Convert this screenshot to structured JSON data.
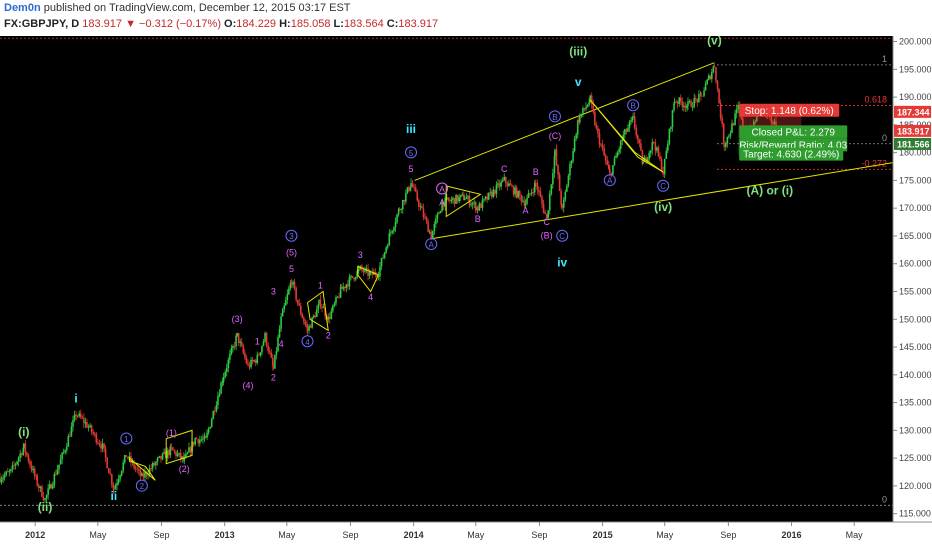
{
  "header": {
    "user": "Dem0n",
    "published": " published on TradingView.com, December 12, 2015 03:17 EST",
    "symbol": "FX:GBPJPY, D",
    "last": "183.917",
    "change": "−0.312 (−0.17%)",
    "open_label": "O:",
    "open": "184.229",
    "high_label": "H:",
    "high": "185.058",
    "low_label": "L:",
    "low": "183.564",
    "close_label": "C:",
    "close": "183.917"
  },
  "colors": {
    "background": "#000000",
    "up": "#2ecc40",
    "down": "#e53935",
    "trendline": "#e6e600",
    "wave_green": "#7ee37e",
    "wave_cyan": "#3ee8ff",
    "wave_magenta": "#e066ff",
    "wave_blue": "#6a6aff"
  },
  "chart_data": {
    "type": "candlestick",
    "title": "",
    "xlabel": "",
    "ylabel": "",
    "x_ticks": [
      "2012",
      "May",
      "Sep",
      "2013",
      "May",
      "Sep",
      "2014",
      "May",
      "Sep",
      "2015",
      "May",
      "Sep",
      "2016",
      "May"
    ],
    "y_ticks": [
      115,
      120,
      125,
      130,
      135,
      140,
      145,
      150,
      155,
      160,
      165,
      170,
      175,
      180,
      185,
      190,
      195,
      200
    ],
    "ylim": [
      113.5,
      201
    ],
    "xlim": [
      "2011-10-25",
      "2016-07-15"
    ],
    "price_path": [
      [
        "2011-10-25",
        121.5
      ],
      [
        "2011-11-15",
        122.5
      ],
      [
        "2011-12-10",
        127
      ],
      [
        "2012-01-05",
        120.5
      ],
      [
        "2012-01-20",
        117.5
      ],
      [
        "2012-02-25",
        126
      ],
      [
        "2012-03-20",
        133
      ],
      [
        "2012-04-10",
        131
      ],
      [
        "2012-05-10",
        127
      ],
      [
        "2012-06-01",
        119.5
      ],
      [
        "2012-06-25",
        125.5
      ],
      [
        "2012-07-25",
        121.5
      ],
      [
        "2012-08-25",
        124.5
      ],
      [
        "2012-09-20",
        126.5
      ],
      [
        "2012-10-15",
        124.5
      ],
      [
        "2012-11-05",
        128.5
      ],
      [
        "2012-11-25",
        128.2
      ],
      [
        "2012-12-30",
        140
      ],
      [
        "2013-01-25",
        147
      ],
      [
        "2013-02-15",
        141.5
      ],
      [
        "2013-03-05",
        143
      ],
      [
        "2013-03-20",
        147
      ],
      [
        "2013-04-05",
        141
      ],
      [
        "2013-04-20",
        150
      ],
      [
        "2013-05-10",
        157
      ],
      [
        "2013-05-25",
        152
      ],
      [
        "2013-06-10",
        148
      ],
      [
        "2013-07-05",
        153
      ],
      [
        "2013-07-20",
        150
      ],
      [
        "2013-08-15",
        155.5
      ],
      [
        "2013-09-20",
        159
      ],
      [
        "2013-10-10",
        158
      ],
      [
        "2013-10-25",
        158.5
      ],
      [
        "2013-11-15",
        165
      ],
      [
        "2013-12-05",
        170
      ],
      [
        "2013-12-27",
        174.5
      ],
      [
        "2014-02-04",
        165
      ],
      [
        "2014-02-25",
        171
      ],
      [
        "2014-04-10",
        172
      ],
      [
        "2014-05-05",
        170
      ],
      [
        "2014-06-25",
        175
      ],
      [
        "2014-08-05",
        171
      ],
      [
        "2014-08-25",
        174.5
      ],
      [
        "2014-09-15",
        168
      ],
      [
        "2014-10-01",
        180
      ],
      [
        "2014-10-15",
        169.5
      ],
      [
        "2014-11-15",
        186
      ],
      [
        "2014-12-08",
        189.5
      ],
      [
        "2014-12-20",
        184
      ],
      [
        "2015-01-15",
        176
      ],
      [
        "2015-02-10",
        183
      ],
      [
        "2015-03-01",
        186
      ],
      [
        "2015-03-20",
        178
      ],
      [
        "2015-04-10",
        182
      ],
      [
        "2015-04-28",
        176.5
      ],
      [
        "2015-05-20",
        189.5
      ],
      [
        "2015-06-15",
        188.5
      ],
      [
        "2015-07-10",
        190
      ],
      [
        "2015-08-05",
        195.8
      ],
      [
        "2015-08-24",
        181.5
      ],
      [
        "2015-09-05",
        184
      ],
      [
        "2015-09-20",
        188
      ],
      [
        "2015-10-05",
        182
      ],
      [
        "2015-11-01",
        188
      ],
      [
        "2015-11-20",
        186
      ],
      [
        "2015-12-11",
        183.9
      ]
    ],
    "price_labels": [
      {
        "text": "187.344",
        "value": 187.344,
        "color": "#e53935"
      },
      {
        "text": "183.917",
        "value": 183.917,
        "color": "#e53935"
      },
      {
        "text": "181.566",
        "value": 181.566,
        "color": "#2e7d32"
      }
    ],
    "fib_levels": [
      {
        "label": "1",
        "value": 195.8,
        "color": "#999999"
      },
      {
        "label": "0.618",
        "value": 188.5,
        "color": "#e53935"
      },
      {
        "label": "0",
        "value": 181.6,
        "color": "#999999"
      },
      {
        "label": "-0.272",
        "value": 177.0,
        "color": "#e53935"
      },
      {
        "label": "0",
        "value": 116.5,
        "color": "#999999"
      }
    ],
    "trade_boxes": [
      {
        "text": "Stop: 1.148 (0.62%)",
        "bg": "#e53935",
        "fg": "#ffffff"
      },
      {
        "text": "Closed P&L: 2.279",
        "bg": "#2e9d2e",
        "fg": "#ffffff"
      },
      {
        "text": "Risk/Reward Ratio: 4.03",
        "bg": "#2e9d2e",
        "fg": "#ffffff"
      },
      {
        "text": "Target: 4.630 (2.49%)",
        "bg": "#2e9d2e",
        "fg": "#ffffff"
      }
    ],
    "wave_labels": [
      {
        "text": "(i)",
        "date": "2011-12-10",
        "value": 129,
        "color": "green"
      },
      {
        "text": "(ii)",
        "date": "2012-01-20",
        "value": 115.5,
        "color": "green"
      },
      {
        "text": "i",
        "date": "2012-03-20",
        "value": 135,
        "color": "cyan"
      },
      {
        "text": "ii",
        "date": "2012-06-01",
        "value": 117.5,
        "color": "cyan"
      },
      {
        "text": "1",
        "date": "2012-06-25",
        "value": 128,
        "color": "blue",
        "circle": true
      },
      {
        "text": "2",
        "date": "2012-07-25",
        "value": 119.5,
        "color": "blue",
        "circle": true
      },
      {
        "text": "(1)",
        "date": "2012-09-20",
        "value": 129,
        "color": "magenta"
      },
      {
        "text": "(2)",
        "date": "2012-10-15",
        "value": 122.5,
        "color": "magenta"
      },
      {
        "text": "(3)",
        "date": "2013-01-25",
        "value": 149.5,
        "color": "magenta"
      },
      {
        "text": "1",
        "date": "2013-03-05",
        "value": 145.5,
        "color": "magenta"
      },
      {
        "text": "2",
        "date": "2013-04-05",
        "value": 139,
        "color": "magenta"
      },
      {
        "text": "(4)",
        "date": "2013-02-15",
        "value": 137.5,
        "color": "magenta"
      },
      {
        "text": "3",
        "date": "2013-04-05",
        "value": 154.5,
        "color": "magenta"
      },
      {
        "text": "4",
        "date": "2013-04-20",
        "value": 145,
        "color": "magenta"
      },
      {
        "text": "(5)",
        "date": "2013-05-10",
        "value": 161.5,
        "color": "magenta"
      },
      {
        "text": "5",
        "date": "2013-05-10",
        "value": 158.5,
        "color": "magenta"
      },
      {
        "text": "3",
        "date": "2013-05-10",
        "value": 164.5,
        "color": "blue",
        "circle": true
      },
      {
        "text": "4",
        "date": "2013-06-10",
        "value": 145.5,
        "color": "blue",
        "circle": true
      },
      {
        "text": "1",
        "date": "2013-07-05",
        "value": 155.5,
        "color": "magenta"
      },
      {
        "text": "2",
        "date": "2013-07-20",
        "value": 146.5,
        "color": "magenta"
      },
      {
        "text": "3",
        "date": "2013-09-20",
        "value": 161,
        "color": "magenta"
      },
      {
        "text": "4",
        "date": "2013-10-10",
        "value": 153.5,
        "color": "magenta"
      },
      {
        "text": "5",
        "date": "2013-12-27",
        "value": 176.5,
        "color": "magenta"
      },
      {
        "text": "5",
        "date": "2013-12-27",
        "value": 179.5,
        "color": "blue",
        "circle": true
      },
      {
        "text": "iii",
        "date": "2013-12-27",
        "value": 183.5,
        "color": "cyan"
      },
      {
        "text": "A",
        "date": "2014-02-04",
        "value": 163,
        "color": "blue",
        "circle": true
      },
      {
        "text": "A",
        "date": "2014-02-25",
        "value": 173,
        "color": "magenta",
        "circle": true
      },
      {
        "text": "A",
        "date": "2014-02-25",
        "value": 170.5,
        "color": "magenta"
      },
      {
        "text": "B",
        "date": "2014-05-05",
        "value": 167.5,
        "color": "magenta"
      },
      {
        "text": "C",
        "date": "2014-06-25",
        "value": 176.5,
        "color": "magenta"
      },
      {
        "text": "A",
        "date": "2014-08-05",
        "value": 169,
        "color": "magenta"
      },
      {
        "text": "B",
        "date": "2014-08-25",
        "value": 176,
        "color": "magenta"
      },
      {
        "text": "C",
        "date": "2014-09-15",
        "value": 167,
        "color": "magenta"
      },
      {
        "text": "(B)",
        "date": "2014-09-15",
        "value": 164.5,
        "color": "magenta"
      },
      {
        "text": "(C)",
        "date": "2014-10-01",
        "value": 182.5,
        "color": "magenta"
      },
      {
        "text": "B",
        "date": "2014-10-01",
        "value": 186,
        "color": "blue",
        "circle": true
      },
      {
        "text": "C",
        "date": "2014-10-15",
        "value": 164.5,
        "color": "blue",
        "circle": true
      },
      {
        "text": "iv",
        "date": "2014-10-15",
        "value": 159.5,
        "color": "cyan"
      },
      {
        "text": "(iii)",
        "date": "2014-11-15",
        "value": 197.5,
        "color": "green"
      },
      {
        "text": "v",
        "date": "2014-11-15",
        "value": 192,
        "color": "cyan"
      },
      {
        "text": "A",
        "date": "2015-01-15",
        "value": 174.5,
        "color": "blue",
        "circle": true
      },
      {
        "text": "B",
        "date": "2015-03-01",
        "value": 188,
        "color": "blue",
        "circle": true
      },
      {
        "text": "C",
        "date": "2015-04-28",
        "value": 173.5,
        "color": "blue",
        "circle": true
      },
      {
        "text": "(iv)",
        "date": "2015-04-28",
        "value": 169.5,
        "color": "green"
      },
      {
        "text": "(v)",
        "date": "2015-08-05",
        "value": 199.5,
        "color": "green"
      },
      {
        "text": "(A) or (i)",
        "date": "2015-11-20",
        "value": 172.5,
        "color": "green"
      }
    ],
    "trendlines": [
      {
        "from": [
          "2014-02-04",
          164.5
        ],
        "to": [
          "2016-07-15",
          178.2
        ]
      },
      {
        "from": [
          "2014-01-03",
          175.0
        ],
        "to": [
          "2015-08-05",
          196.2
        ]
      }
    ]
  }
}
